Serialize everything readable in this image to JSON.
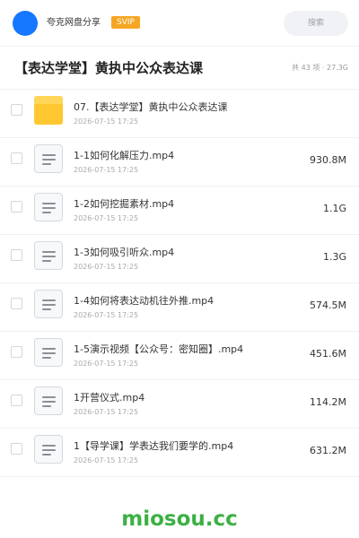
{
  "header": {
    "uploader_name": "夸克网盘分享",
    "vip_badge": "SVIP",
    "search_placeholder": "搜索",
    "avatar_color": "#1677ff"
  },
  "share": {
    "title": "【表达学堂】黄执中公众表达课",
    "summary": "共 43 项 · 27.3G"
  },
  "files": [
    {
      "type": "folder",
      "name": "07.【表达学堂】黄执中公众表达课",
      "date": "2026-07-15 17:25",
      "size": ""
    },
    {
      "type": "video",
      "name": "1-1如何化解压力.mp4",
      "date": "2026-07-15 17:25",
      "size": "930.8M"
    },
    {
      "type": "video",
      "name": "1-2如何挖掘素材.mp4",
      "date": "2026-07-15 17:25",
      "size": "1.1G"
    },
    {
      "type": "video",
      "name": "1-3如何吸引听众.mp4",
      "date": "2026-07-15 17:25",
      "size": "1.3G"
    },
    {
      "type": "video",
      "name": "1-4如何将表达动机往外推.mp4",
      "date": "2026-07-15 17:25",
      "size": "574.5M"
    },
    {
      "type": "video",
      "name": "1-5演示视频【公众号：密知圈】.mp4",
      "date": "2026-07-15 17:25",
      "size": "451.6M"
    },
    {
      "type": "video",
      "name": "1开营仪式.mp4",
      "date": "2026-07-15 17:25",
      "size": "114.2M"
    },
    {
      "type": "video",
      "name": "1【导学课】学表达我们要学的.mp4",
      "date": "2026-07-15 17:25",
      "size": "631.2M"
    }
  ],
  "watermark": "miosou.cc",
  "colors": {
    "accent": "#1677ff",
    "vip": "#f5a623",
    "folder": "#ffc832",
    "watermark": "#3cb043"
  }
}
